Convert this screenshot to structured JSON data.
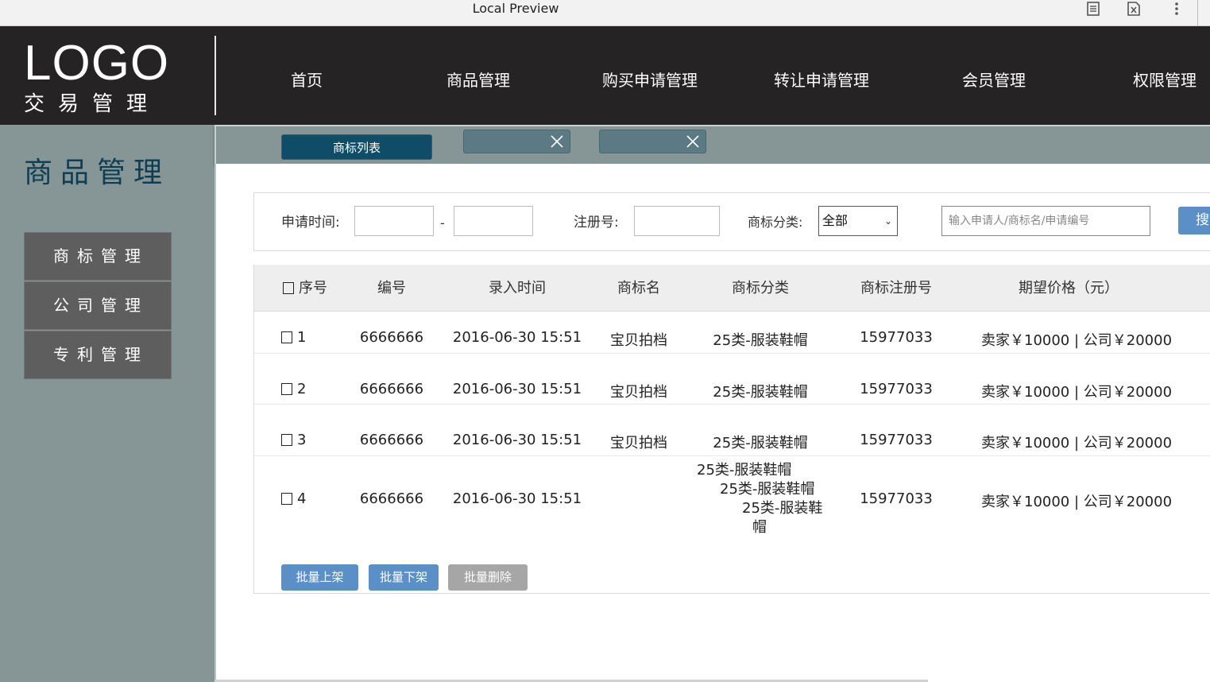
{
  "browser": {
    "title": "Local Preview"
  },
  "header": {
    "logo": "LOGO",
    "logo_subtitle": "交易管理",
    "nav": [
      {
        "label": "首页"
      },
      {
        "label": "商品管理"
      },
      {
        "label": "购买申请管理"
      },
      {
        "label": "转让申请管理"
      },
      {
        "label": "会员管理"
      },
      {
        "label": "权限管理"
      }
    ]
  },
  "sidebar": {
    "title": "商品管理",
    "items": [
      {
        "label": "商标管理"
      },
      {
        "label": "公司管理"
      },
      {
        "label": "专利管理"
      }
    ]
  },
  "tabs": {
    "active_label": "商标列表"
  },
  "filter": {
    "date_label": "申请时间:",
    "date_separator": "-",
    "reg_label": "注册号:",
    "category_label": "商标分类:",
    "category_value": "全部",
    "search_placeholder": "输入申请人/商标名/申请编号",
    "search_button": "搜"
  },
  "table": {
    "headers": [
      "序号",
      "编号",
      "录入时间",
      "商标名",
      "商标分类",
      "商标注册号",
      "期望价格（元）"
    ],
    "rows": [
      {
        "index": "1",
        "code": "6666666",
        "time": "2016-06-30 15:51",
        "name": "宝贝拍档",
        "category": "25类-服装鞋帽",
        "reg_no": "15977033",
        "price": "卖家￥10000 | 公司￥20000"
      },
      {
        "index": "2",
        "code": "6666666",
        "time": "2016-06-30 15:51",
        "name": "宝贝拍档",
        "category": "25类-服装鞋帽",
        "reg_no": "15977033",
        "price": "卖家￥10000 | 公司￥20000"
      },
      {
        "index": "3",
        "code": "6666666",
        "time": "2016-06-30 15:51",
        "name": "宝贝拍档",
        "category": "25类-服装鞋帽",
        "reg_no": "15977033",
        "price": "卖家￥10000 | 公司￥20000"
      },
      {
        "index": "4",
        "code": "6666666",
        "time": "2016-06-30 15:51",
        "name": "",
        "category_lines": [
          "25类-服装鞋帽",
          "25类-服装鞋帽",
          "25类-服装鞋",
          "帽"
        ],
        "reg_no": "15977033",
        "price": "卖家￥10000 | 公司￥20000"
      }
    ]
  },
  "actions": {
    "batch_up": "批量上架",
    "batch_down": "批量下架",
    "batch_delete": "批量删除"
  },
  "colors": {
    "header_bg": "#252323",
    "sidebar_bg": "#869595",
    "accent_dark": "#0e4c68",
    "button_blue": "#5a8fc7",
    "button_gray": "#a6a6a6"
  }
}
